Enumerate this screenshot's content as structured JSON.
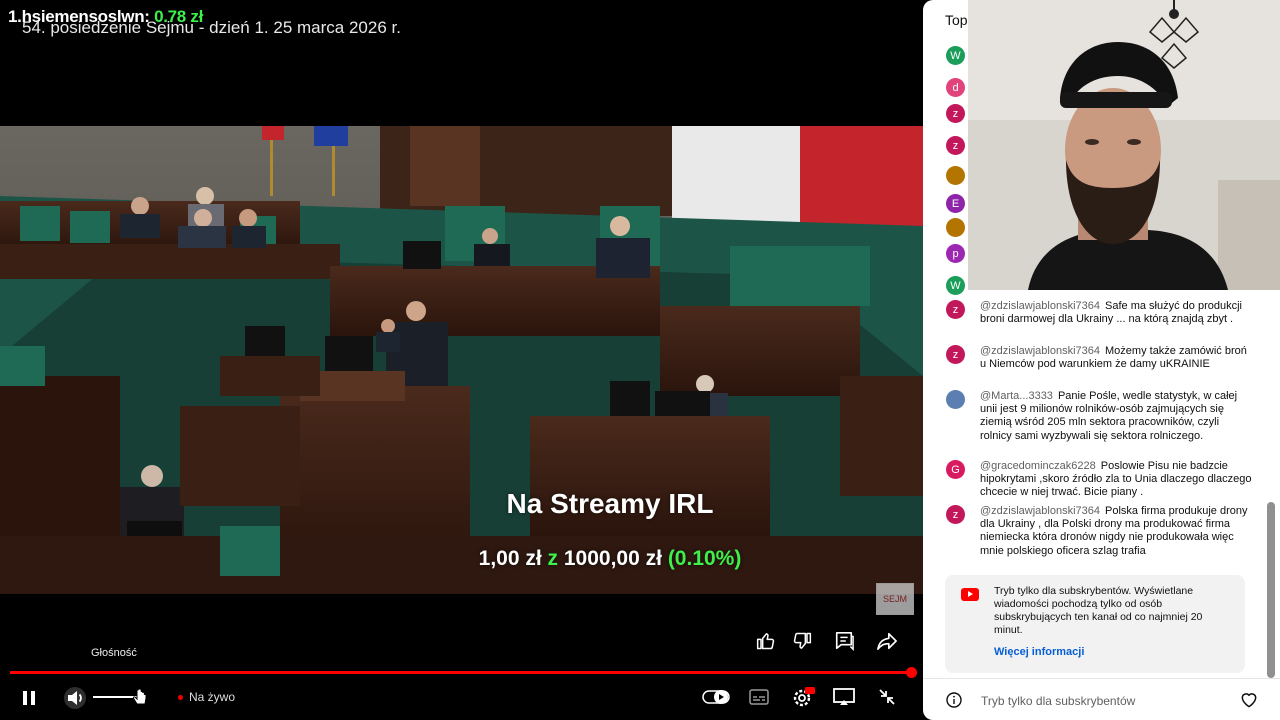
{
  "overlay": {
    "leader_label": "1.hsiemensoslwn:",
    "leader_amount": "0.78 zł",
    "goal_title": "Na Streamy IRL",
    "goal_current": "1,00 zł",
    "goal_sep": "z",
    "goal_target": "1000,00 zł",
    "goal_percent": "(0.10%)",
    "goal_progress": 0.001
  },
  "video": {
    "title": "54. posiedzenie Sejmu - dzień 1. 25 marca 2026 r.",
    "watermark": "SEJM"
  },
  "player": {
    "volume_label": "Głośność",
    "live_label": "Na żywo",
    "progress": 0.997,
    "volume_level": 0.9,
    "icons": {
      "like": "thumbs-up-icon",
      "dislike": "thumbs-down-icon",
      "comments": "comments-icon",
      "share": "share-icon",
      "pause": "pause-icon",
      "volume": "volume-icon",
      "autoplay": "autoplay-toggle-icon",
      "subtitles": "subtitles-icon",
      "settings": "settings-icon",
      "miniplayer": "cast-icon",
      "exit_fullscreen": "exit-fullscreen-icon"
    },
    "colors": {
      "progress": "#ff0000",
      "live_dot": "#e00000"
    }
  },
  "chat": {
    "header": "Top",
    "avatar_letters": [
      "W",
      "d",
      "z",
      "z",
      "",
      "E",
      "",
      "p",
      "W"
    ],
    "avatar_colors": [
      "#1b9e5a",
      "#e0447a",
      "#c2185b",
      "#c2185b",
      "#b37400",
      "#8e24aa",
      "#b37400",
      "#9c27b0",
      "#1b9e5a"
    ],
    "messages": [
      {
        "avatar": "z",
        "color": "#c2185b",
        "author": "@zdzislawjablonski7364",
        "text": "Safe ma służyć do produkcji broni darmowej dla Ukrainy ... na którą znajdą zbyt ."
      },
      {
        "avatar": "z",
        "color": "#c2185b",
        "author": "@zdzislawjablonski7364",
        "text": "Możemy także zamówić broń u Niemców pod warunkiem że damy uKRAINIE"
      },
      {
        "avatar": "",
        "color": "#5a7fb0",
        "author": "@Marta...3333",
        "text": "Panie Pośle, wedle statystyk, w całej unii jest 9 milionów rolników-osób zajmujących się ziemią wśród 205 mln sektora pracowników, czyli rolnicy sami wyzbywali się sektora rolniczego."
      },
      {
        "avatar": "G",
        "color": "#d81b60",
        "author": "@gracedominczak6228",
        "text": "Poslowie Pisu nie badzcie hipokrytami ,skoro źródło zla to Unia dlaczego dlaczego chcecie w niej trwać. Bicie piany ."
      },
      {
        "avatar": "z",
        "color": "#c2185b",
        "author": "@zdzislawjablonski7364",
        "text": "Polska firma produkuje drony dla Ukrainy , dla Polski drony ma produkować firma niemiecka która dronów nigdy nie produkowała więc mnie polskiego oficera szlag trafia"
      }
    ],
    "notice_text": "Tryb tylko dla subskrybentów. Wyświetlane wiadomości pochodzą tylko od osób subskrybujących ten kanał od co najmniej 20 minut.",
    "notice_link": "Więcej informacji",
    "input_placeholder": "Tryb tylko dla subskrybentów"
  }
}
